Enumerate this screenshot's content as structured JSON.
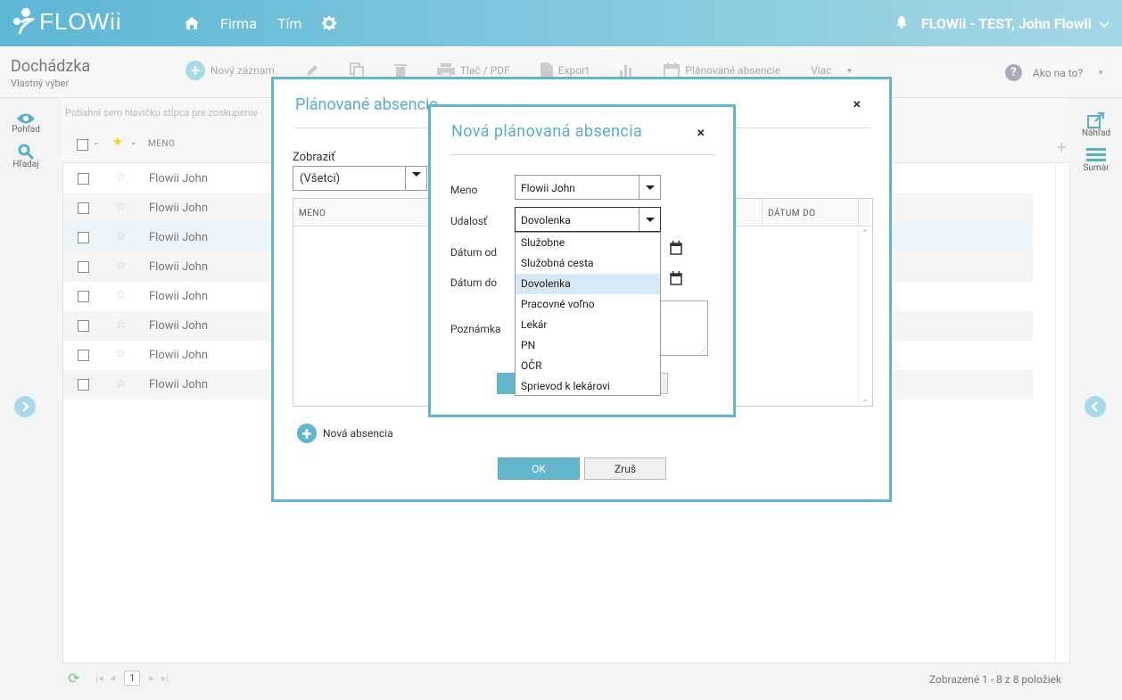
{
  "app": {
    "logo_text": "FLOWii",
    "nav": {
      "firma": "Firma",
      "tim": "Tím"
    },
    "user": "FLOWii - TEST, John Flowii"
  },
  "toolbar": {
    "title": "Dochádzka",
    "subtitle": "Vlastný výber",
    "new_record": "Nový záznam",
    "print_pdf": "Tlač / PDF",
    "export": "Export",
    "planned_absences": "Plánované absencie",
    "more": "Viac",
    "help": "Ako na to?"
  },
  "side_left": {
    "view": "Pohľad",
    "search": "Hľadaj"
  },
  "side_right": {
    "preview": "Náhľad",
    "summary": "Sumár"
  },
  "grid": {
    "group_hint": "Potiahni sem hlavičku stĺpca pre zoskupenie",
    "col_meno": "MENO",
    "rows": [
      {
        "name": "Flowii John"
      },
      {
        "name": "Flowii John"
      },
      {
        "name": "Flowii John"
      },
      {
        "name": "Flowii John"
      },
      {
        "name": "Flowii John"
      },
      {
        "name": "Flowii John"
      },
      {
        "name": "Flowii John"
      },
      {
        "name": "Flowii John"
      }
    ],
    "page": "1",
    "shown": "Zobrazené 1 - 8 z 8 položiek"
  },
  "modal1": {
    "title": "Plánované absencie",
    "close": "×",
    "show_label": "Zobraziť",
    "show_value": "(Všetci)",
    "col_meno": "MENO",
    "col_datum_do": "DÁTUM DO",
    "add_absence": "Nová absencia",
    "ok": "OK",
    "cancel": "Zruš"
  },
  "modal2": {
    "title": "Nová plánovaná absencia",
    "close": "×",
    "label_meno": "Meno",
    "value_meno": "Flowii John",
    "label_event": "Udalosť",
    "value_event": "Dovolenka",
    "label_date_from": "Dátum od",
    "label_date_to": "Dátum do",
    "label_note": "Poznámka"
  },
  "dropdown": {
    "options": [
      "Služobne",
      "Služobná cesta",
      "Dovolenka",
      "Pracovné voľno",
      "Lekár",
      "PN",
      "OČR",
      "Sprievod k lekárovi"
    ],
    "selected_index": 2
  },
  "colors": {
    "accent": "#62b5ca",
    "header_from": "#5eb7d5",
    "header_to": "#a4d7e6"
  }
}
